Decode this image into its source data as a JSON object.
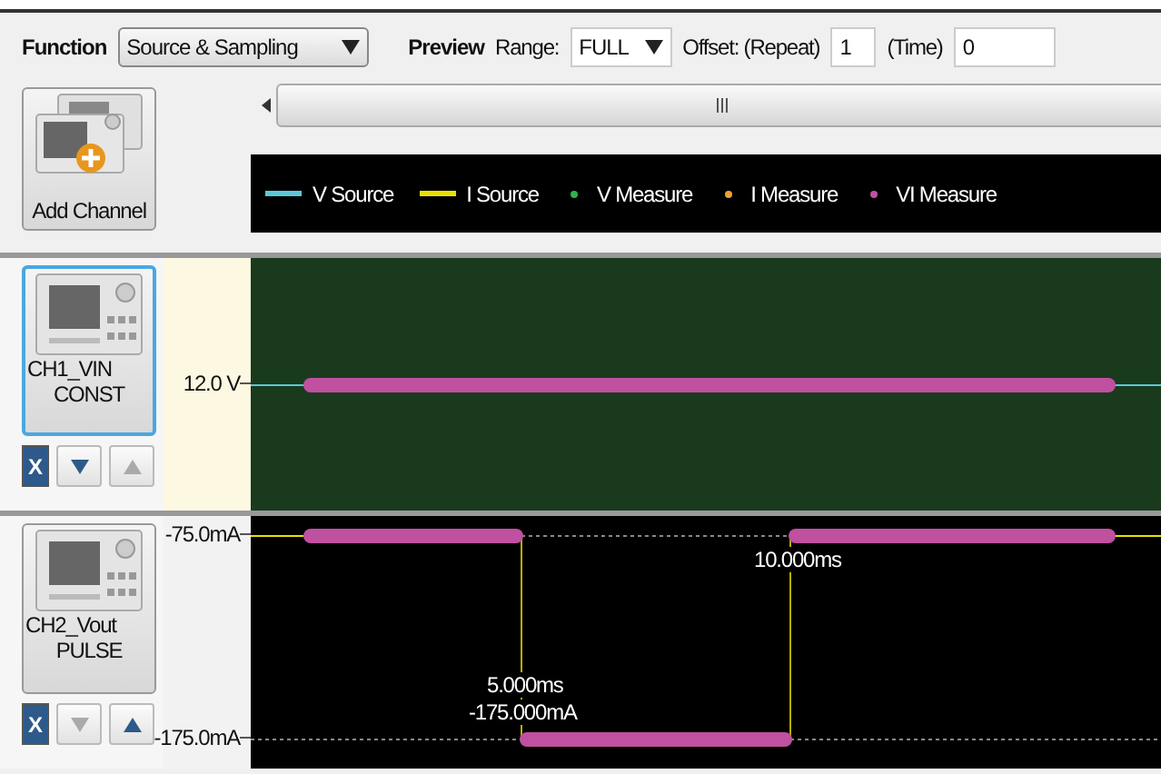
{
  "toolbar": {
    "function_label": "Function",
    "function_value": "Source & Sampling",
    "preview_label": "Preview",
    "range_label": "Range:",
    "range_value": "FULL",
    "offset_label": "Offset: (Repeat)",
    "repeat_value": "1",
    "time_label": "(Time)",
    "time_value": "0"
  },
  "add_channel": {
    "label": "Add Channel"
  },
  "legend": [
    {
      "label": "V Source",
      "kind": "line",
      "color": "#5bc8d8"
    },
    {
      "label": "I Source",
      "kind": "line",
      "color": "#e8e000"
    },
    {
      "label": "V Measure",
      "kind": "dot",
      "color": "#2db34a"
    },
    {
      "label": "I Measure",
      "kind": "dot",
      "color": "#f0a030"
    },
    {
      "label": "VI Measure",
      "kind": "dot",
      "color": "#c050a0"
    }
  ],
  "channels": [
    {
      "name": "CH1_VIN",
      "mode": "CONST",
      "selected": true,
      "remove_label": "X",
      "down_disabled": false,
      "up_disabled": true,
      "kind": "constant",
      "axis_labels": [
        "12.0 V"
      ]
    },
    {
      "name": "CH2_Vout",
      "mode": "PULSE",
      "selected": false,
      "remove_label": "X",
      "down_disabled": true,
      "up_disabled": false,
      "kind": "pulse",
      "axis_labels": [
        "-75.0mA",
        "-175.0mA"
      ],
      "annotations": [
        "10.000ms",
        "5.000ms",
        "-175.000mA"
      ]
    }
  ]
}
